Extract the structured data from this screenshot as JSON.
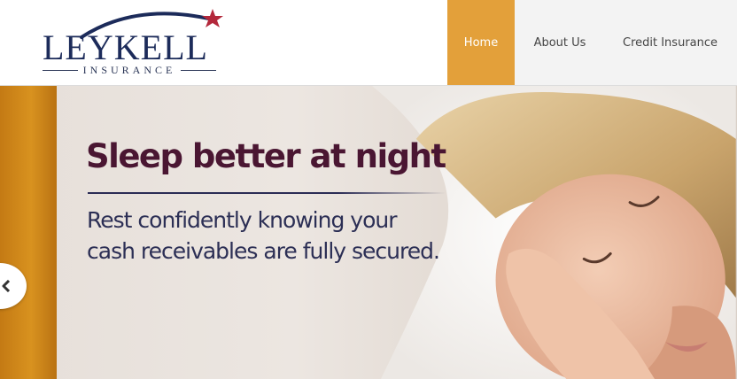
{
  "logo": {
    "name": "LEYKELL",
    "tagline": "INSURANCE"
  },
  "nav": {
    "items": [
      {
        "label": "Home",
        "active": true
      },
      {
        "label": "About Us",
        "active": false
      },
      {
        "label": "Credit Insurance",
        "active": false
      }
    ]
  },
  "banner": {
    "headline": "Sleep better at night",
    "subtext_line1": "Rest confidently knowing your",
    "subtext_line2": "cash receivables are fully secured."
  },
  "colors": {
    "accent": "#e3a03a",
    "brand_navy": "#1c2b5a",
    "headline": "#4a1632",
    "star": "#b3283b"
  },
  "icons": {
    "prev": "chevron-left-icon",
    "logo_star": "star-icon"
  }
}
